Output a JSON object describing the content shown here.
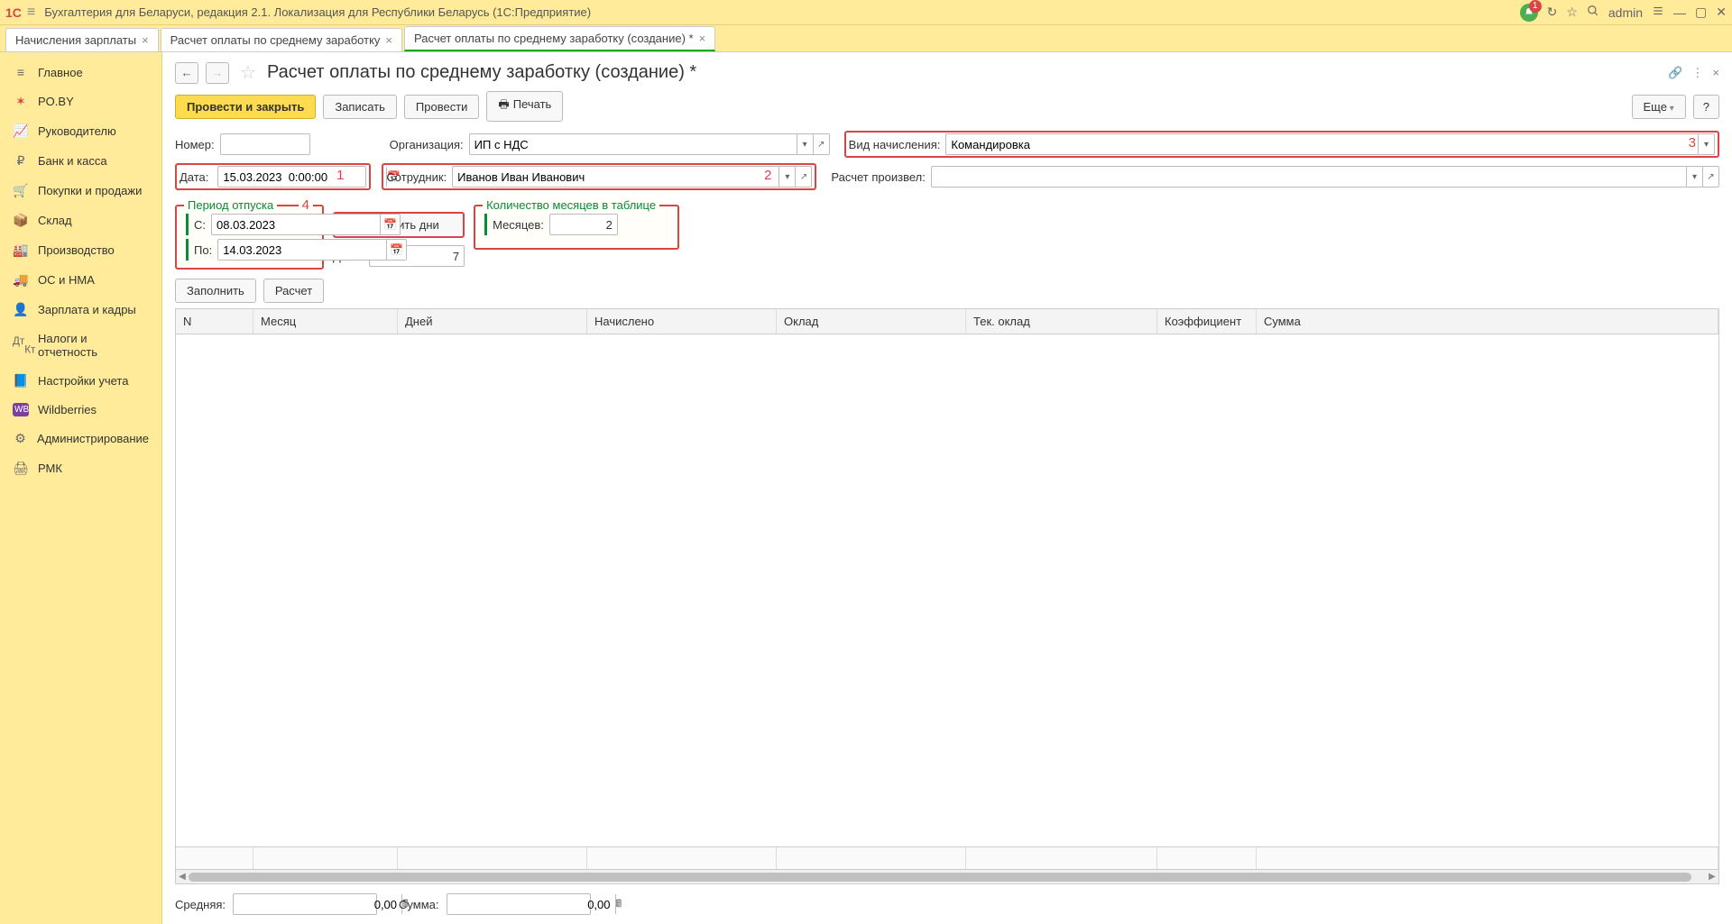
{
  "titlebar": {
    "app_title": "Бухгалтерия для Беларуси, редакция 2.1. Локализация для Республики Беларусь   (1С:Предприятие)",
    "username": "admin",
    "bell_badge": "1"
  },
  "tabs": [
    {
      "label": "Начисления зарплаты"
    },
    {
      "label": "Расчет оплаты по среднему заработку"
    },
    {
      "label": "Расчет оплаты по среднему заработку (создание) *",
      "active": true
    }
  ],
  "sidebar": {
    "items": [
      {
        "label": "Главное"
      },
      {
        "label": "PO.BY"
      },
      {
        "label": "Руководителю"
      },
      {
        "label": "Банк и касса"
      },
      {
        "label": "Покупки и продажи"
      },
      {
        "label": "Склад"
      },
      {
        "label": "Производство"
      },
      {
        "label": "ОС и НМА"
      },
      {
        "label": "Зарплата и кадры"
      },
      {
        "label": "Налоги и отчетность"
      },
      {
        "label": "Настройки учета"
      },
      {
        "label": "Wildberries"
      },
      {
        "label": "Администрирование"
      },
      {
        "label": "РМК"
      }
    ]
  },
  "page": {
    "title": "Расчет оплаты по среднему заработку (создание) *"
  },
  "toolbar": {
    "post_close": "Провести и закрыть",
    "save": "Записать",
    "post": "Провести",
    "print": "Печать",
    "more": "Еще",
    "help": "?"
  },
  "fields": {
    "number_label": "Номер:",
    "number_value": "",
    "org_label": "Организация:",
    "org_value": "ИП с НДС",
    "accrual_type_label": "Вид начисления:",
    "accrual_type_value": "Командировка",
    "date_label": "Дата:",
    "date_value": "15.03.2023  0:00:00",
    "employee_label": "Сотрудник:",
    "employee_value": "Иванов Иван Иванович",
    "calcby_label": "Расчет произвел:",
    "calcby_value": ""
  },
  "annotations": {
    "a1": "1",
    "a2": "2",
    "a3": "3",
    "a4": "4"
  },
  "period_group": {
    "title": "Период отпуска",
    "from_label": "С:",
    "from_value": "08.03.2023",
    "to_label": "По:",
    "to_value": "14.03.2023"
  },
  "fill_days_btn": "Заполнить дни",
  "days_label": "Дней:",
  "days_value": "7",
  "months_group": {
    "title": "Количество месяцев в таблице",
    "label": "Месяцев:",
    "value": "2"
  },
  "actions": {
    "fill": "Заполнить",
    "calc": "Расчет"
  },
  "table": {
    "cols": {
      "n": "N",
      "month": "Месяц",
      "days": "Дней",
      "accrued": "Начислено",
      "oklad": "Оклад",
      "tek_oklad": "Тек. оклад",
      "koef": "Коэффициент",
      "summa": "Сумма"
    }
  },
  "footer": {
    "avg_label": "Средняя:",
    "avg_value": "0,00",
    "sum_label": "Сумма:",
    "sum_value": "0,00"
  }
}
